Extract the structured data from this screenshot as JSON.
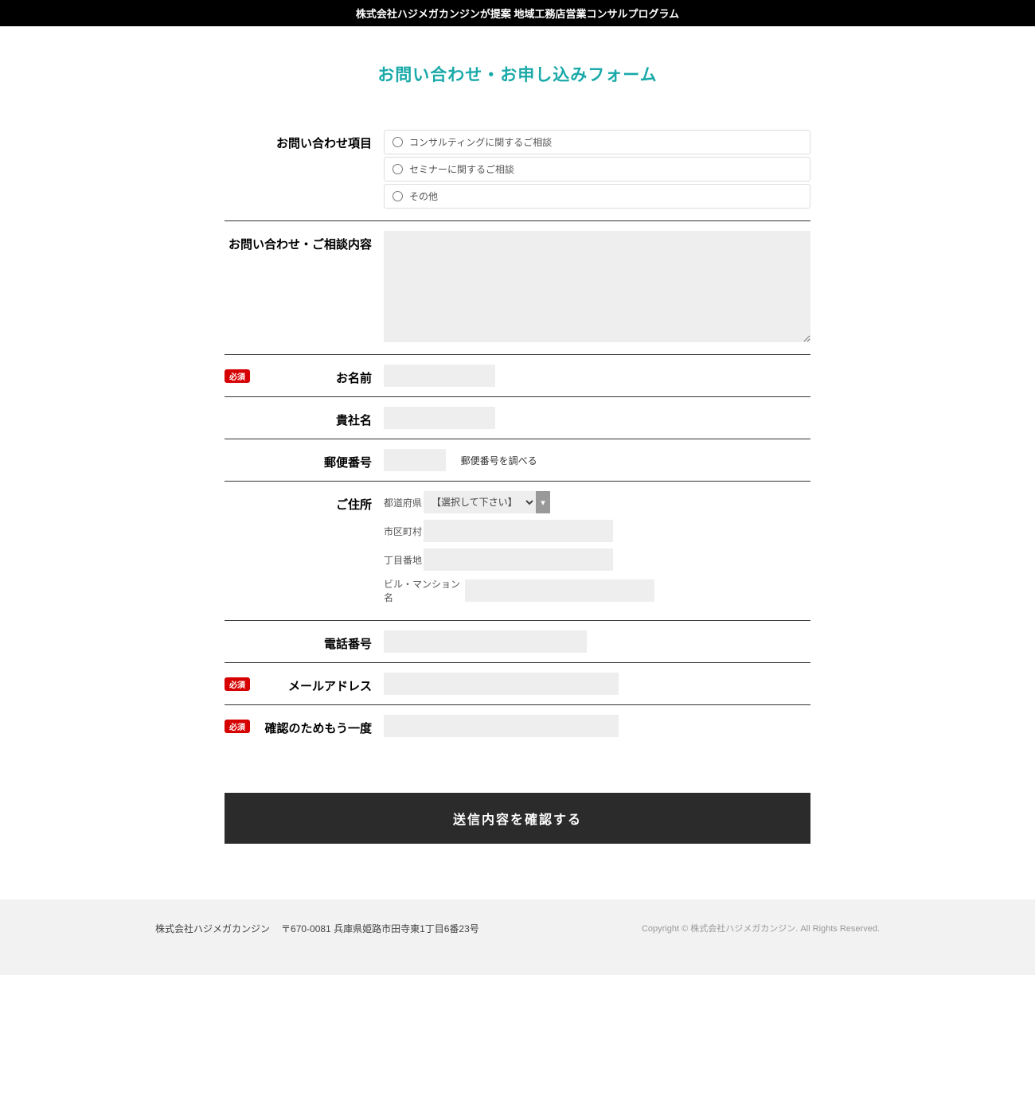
{
  "header": {
    "title": "株式会社ハジメガカンジンが提案 地域工務店営業コンサルプログラム"
  },
  "form": {
    "title": "お問い合わせ・お申し込みフォーム",
    "required_label": "必須",
    "submit_label": "送信内容を確認する",
    "fields": {
      "inquiry_type": {
        "label": "お問い合わせ項目",
        "options": [
          "コンサルティングに関するご相談",
          "セミナーに関するご相談",
          "その他"
        ]
      },
      "content": {
        "label": "お問い合わせ・ご相談内容"
      },
      "name": {
        "label": "お名前",
        "required": true
      },
      "company": {
        "label": "貴社名"
      },
      "zip": {
        "label": "郵便番号",
        "note": "郵便番号を調べる"
      },
      "address": {
        "label": "ご住所",
        "pref_label": "都道府県",
        "pref_selected": "【選択して下さい】",
        "city_label": "市区町村",
        "street_label": "丁目番地",
        "building_label": "ビル・マンション名"
      },
      "phone": {
        "label": "電話番号"
      },
      "email": {
        "label": "メールアドレス",
        "required": true
      },
      "email_confirm": {
        "label": "確認のためもう一度",
        "required": true
      }
    }
  },
  "footer": {
    "company": "株式会社ハジメガカンジン",
    "address": "〒670-0081 兵庫県姫路市田寺東1丁目6番23号",
    "copyright": "Copyright © 株式会社ハジメガカンジン. All Rights Reserved."
  }
}
